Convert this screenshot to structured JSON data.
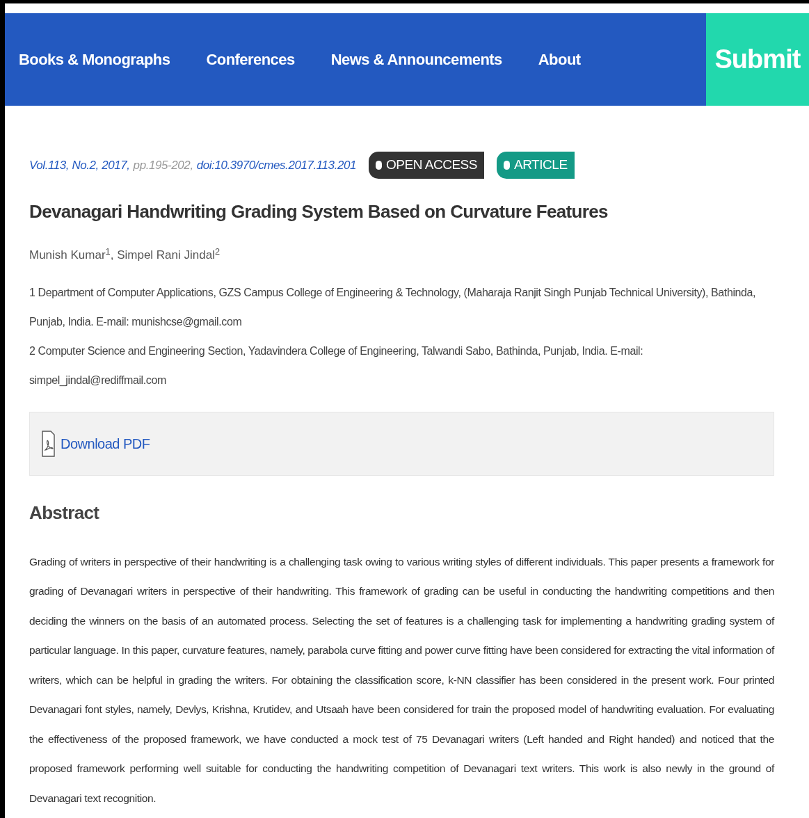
{
  "nav": {
    "items": [
      "Books & Monographs",
      "Conferences",
      "News & Announcements",
      "About"
    ],
    "submit": "Submit"
  },
  "citation": [
    {
      "text": "Vol.113, No.2, 2017,",
      "kind": "link"
    },
    {
      "text": "pp.195-202,",
      "kind": "plain"
    },
    {
      "text": "doi:10.3970/cmes.2017.113.201",
      "kind": "link"
    }
  ],
  "badges": [
    {
      "label": "OPEN ACCESS",
      "color": "#333333"
    },
    {
      "label": "ARTICLE",
      "color": "#149a86"
    }
  ],
  "title": "Devanagari Handwriting Grading System Based on Curvature Features",
  "authors": "Munish Kumar$^{1}$, Simpel Rani Jindal$^{2}$",
  "affiliations": [
    "1 Department of Computer Applications, GZS Campus College of Engineering & Technology, (Maharaja Ranjit Singh Punjab Technical University), Bathinda, Punjab, India. E-mail: munishcse@gmail.com",
    "2 Computer Science and Engineering Section, Yadavindera College of Engineering, Talwandi Sabo, Bathinda, Punjab, India. E-mail: simpel_jindal@rediffmail.com"
  ],
  "download": "Download PDF",
  "abstract": {
    "heading": "Abstract",
    "text": "Grading of writers in perspective of their handwriting is a challenging task owing to various writing styles of different individuals. This paper presents a framework for grading of Devanagari writers in perspective of their handwriting. This framework of grading can be useful in conducting the handwriting competitions and then deciding the winners on the basis of an automated process. Selecting the set of features is a challenging task for implementing a handwriting grading system of particular language. In this paper, curvature features, namely, parabola curve fitting and power curve fitting have been considered for extracting the vital information of writers, which can be helpful in grading the writers. For obtaining the classification score, k-NN classifier has been considered in the present work. Four printed Devanagari font styles, namely, Devlys, Krishna, Krutidev, and Utsaah have been considered for train the proposed model of handwriting evaluation. For evaluating the effectiveness of the proposed framework, we have conducted a mock test of 75 Devanagari writers (Left handed and Right handed) and noticed that the proposed framework performing well suitable for conducting the handwriting competition of Devanagari text writers. This work is also newly in the ground of Devanagari text recognition."
  }
}
